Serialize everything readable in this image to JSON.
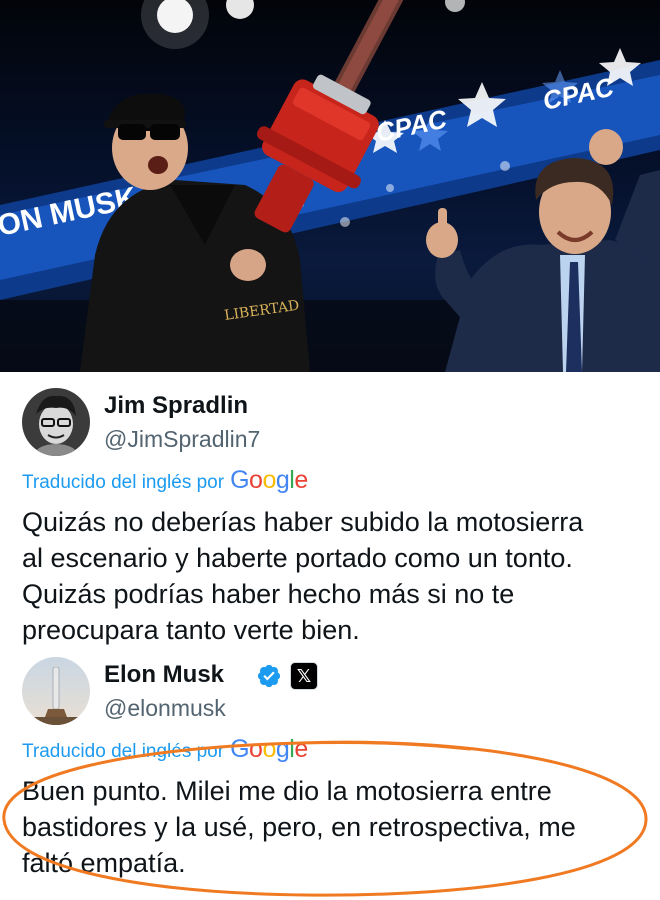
{
  "photo": {
    "banner_text_left": "ON MUSK",
    "banner_text_right_1": "CPAC",
    "banner_text_right_2": "CPAC",
    "chainsaw_text": "LIBERTAD"
  },
  "tweets": [
    {
      "name": "Jim Spradlin",
      "handle": "@JimSpradlin7",
      "translated_label": "Traducido del inglés por",
      "translation_provider": "Google",
      "lines": [
        "Quizás no deberías haber subido la motosierra",
        "al escenario y haberte portado como un tonto.",
        "Quizás podrías haber hecho más si no te",
        "preocupara tanto verte bien."
      ]
    },
    {
      "name": "Elon Musk",
      "handle": "@elonmusk",
      "verified": true,
      "affiliate_badge": "𝕏",
      "translated_label": "Traducido del inglés por",
      "translation_provider": "Google",
      "lines": [
        "Buen punto. Milei me dio la motosierra entre",
        "bastidores y la usé, pero, en retrospectiva, me",
        "faltó empatía."
      ]
    }
  ],
  "annotation": {
    "color": "#f07a22",
    "shape": "ellipse-icon"
  },
  "colors": {
    "link_blue": "#1d9bf0",
    "handle_gray": "#536471",
    "verified_blue": "#1d9bf0"
  }
}
